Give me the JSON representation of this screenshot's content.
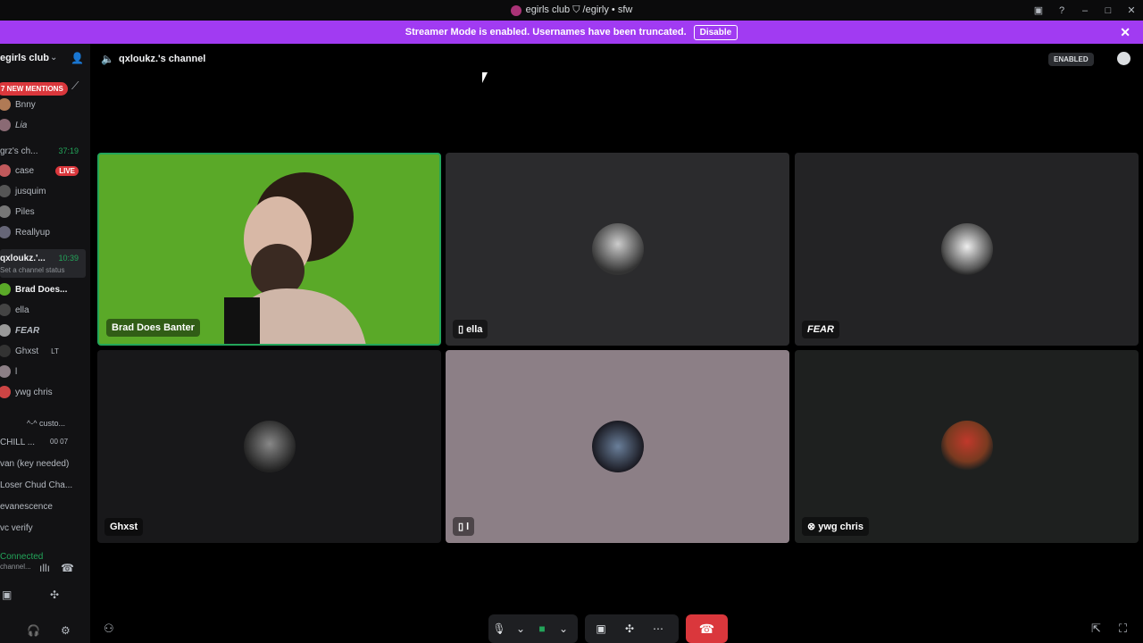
{
  "window": {
    "title": "egirls club ⛉ /egirly • sfw"
  },
  "banner": {
    "text": "Streamer Mode is enabled. Usernames have been truncated.",
    "disable_label": "Disable"
  },
  "sidebar": {
    "server_name": "egirls club",
    "mentions_label": "7 NEW MENTIONS",
    "users_top": [
      {
        "name": "Bnny"
      },
      {
        "name": "Lia"
      }
    ],
    "channel1": {
      "name": "grz's ch...",
      "time": "37:19"
    },
    "channel1_users": [
      {
        "name": "case",
        "badge": "LIVE"
      },
      {
        "name": "jusquim"
      },
      {
        "name": "Piles"
      },
      {
        "name": "Reallyup"
      }
    ],
    "channel2": {
      "name": "qxloukz.'...",
      "time": "10:39",
      "status": "Set a channel status"
    },
    "channel2_users": [
      {
        "name": "Brad Does..."
      },
      {
        "name": "ella"
      },
      {
        "name": "FEAR"
      },
      {
        "name": "Ghxst",
        "badge": "LT"
      },
      {
        "name": "l"
      },
      {
        "name": "ywg chris"
      }
    ],
    "category": "^-^ custo...",
    "channels": [
      {
        "name": "CHILL ...",
        "counts": "00  07"
      },
      {
        "name": "van (key needed)"
      },
      {
        "name": "Loser Chud Cha..."
      },
      {
        "name": "evanescence"
      },
      {
        "name": "vc verify"
      }
    ],
    "voice_status": {
      "label": "Connected",
      "sub": "channel..."
    }
  },
  "topbar": {
    "channel_name": "qxloukz.'s channel",
    "enabled_label": "ENABLED"
  },
  "tiles": [
    {
      "name": "Brad Does Banter"
    },
    {
      "name": "ella"
    },
    {
      "name": "FEAR"
    },
    {
      "name": "Ghxst"
    },
    {
      "name": "l"
    },
    {
      "name": "ywg chris"
    }
  ]
}
